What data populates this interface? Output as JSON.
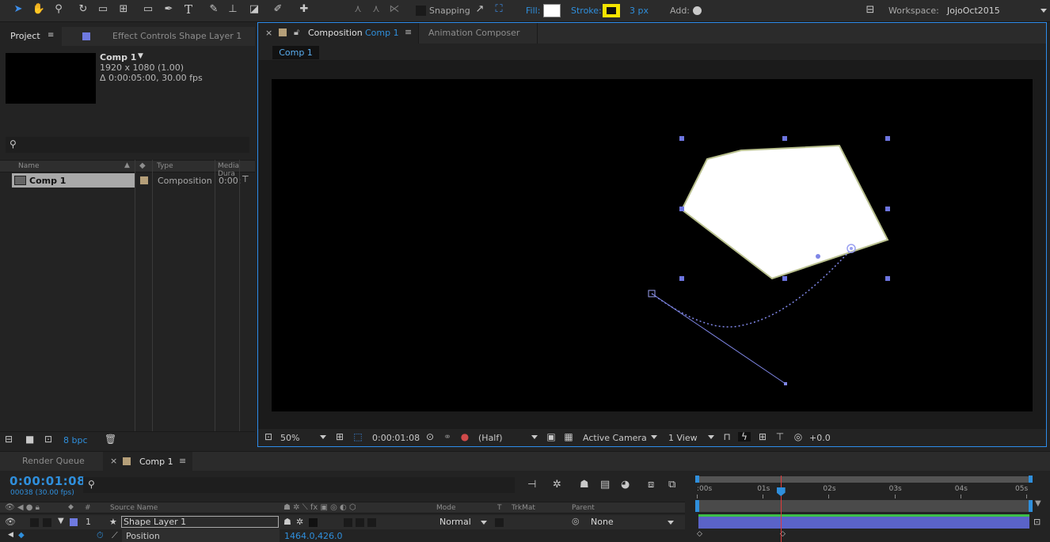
{
  "toolbar": {
    "snapping_label": "Snapping",
    "fill_label": "Fill:",
    "stroke_label": "Stroke:",
    "stroke_width": "3 px",
    "add_label": "Add:",
    "workspace_label": "Workspace:",
    "workspace_value": "JojoOct2015",
    "colors": {
      "fill": "#ffffff",
      "stroke": "#f5e400",
      "accent": "#2f8fdc"
    }
  },
  "project": {
    "tab_project": "Project",
    "tab_effects": "Effect Controls  Shape Layer 1",
    "comp_name": "Comp 1",
    "comp_res": "1920 x 1080 (1.00)",
    "comp_duration": "Δ 0:00:05:00, 30.00 fps",
    "columns": {
      "name": "Name",
      "type": "Type",
      "media_duration": "Media Dura"
    },
    "item": {
      "name": "Comp 1",
      "type": "Composition",
      "duration": "0:00:"
    },
    "bpc": "8 bpc"
  },
  "comp_panel": {
    "tab_composition": "Composition",
    "tab_comp_name": "Comp 1",
    "tab_animation": "Animation Composer",
    "breadcrumb": "Comp 1",
    "zoom": "50%",
    "timecode": "0:00:01:08",
    "resolution": "(Half)",
    "camera": "Active Camera",
    "view": "1 View",
    "exposure": "+0.0"
  },
  "timeline": {
    "tab_render": "Render Queue",
    "tab_comp": "Comp 1",
    "timecode": "0:00:01:08",
    "frames": "00038 (30.00 fps)",
    "columns": {
      "num": "#",
      "source": "Source Name",
      "mode": "Mode",
      "t": "T",
      "trkmat": "TrkMat",
      "parent": "Parent"
    },
    "layer": {
      "index": "1",
      "name": "Shape Layer 1",
      "mode": "Normal",
      "parent": "None"
    },
    "property": {
      "name": "Position",
      "value": "1464.0,426.0"
    },
    "ruler_ticks": [
      ":00s",
      "01s",
      "02s",
      "03s",
      "04s",
      "05s"
    ],
    "current_time_seconds": 1.27
  }
}
